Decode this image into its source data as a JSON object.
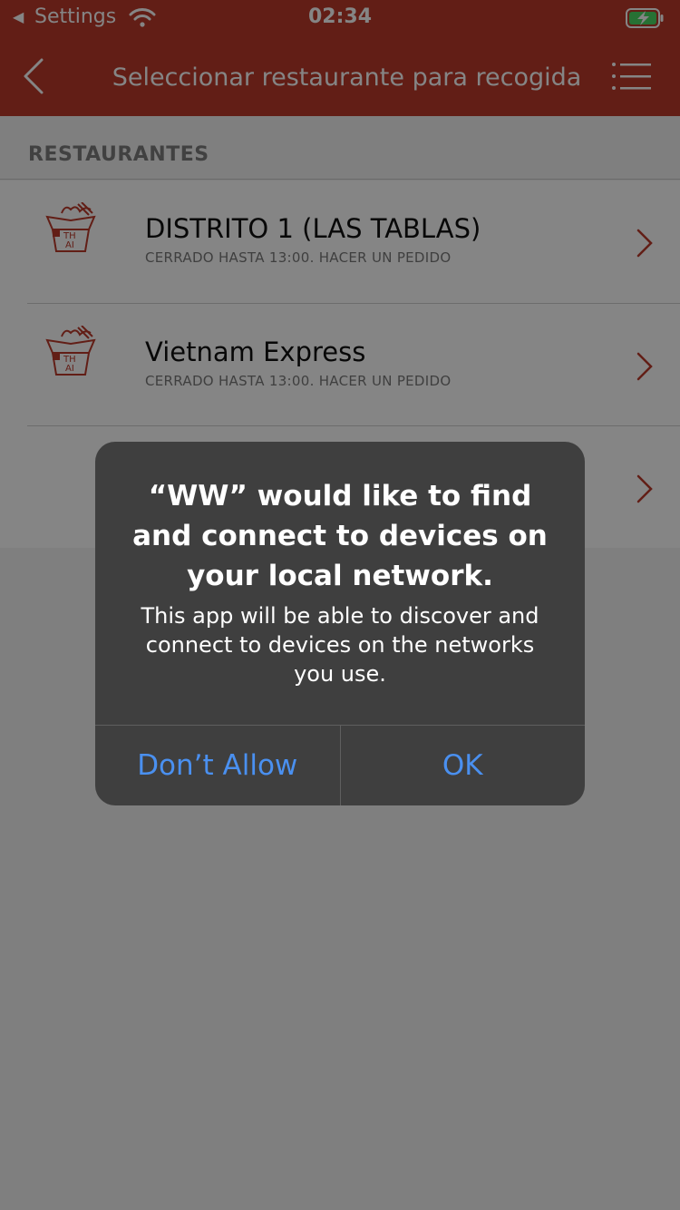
{
  "status_bar": {
    "back_app": "Settings",
    "time": "02:34"
  },
  "nav": {
    "title": "Seleccionar restaurante para recogida"
  },
  "section": {
    "header": "RESTAURANTES"
  },
  "restaurants": [
    {
      "name": "DISTRITO 1 (LAS TABLAS)",
      "status": "CERRADO HASTA 13:00. HACER UN PEDIDO",
      "icon": "thai-box-icon"
    },
    {
      "name": "Vietnam Express",
      "status": "CERRADO HASTA 13:00. HACER UN PEDIDO",
      "icon": "thai-box-icon"
    },
    {
      "name": "",
      "status": "",
      "icon": ""
    }
  ],
  "dialog": {
    "title": "“WW” would like to find and connect to devices on your local network.",
    "message": "This app will be able to discover and connect to devices on the networks you use.",
    "deny_label": "Don’t Allow",
    "ok_label": "OK"
  },
  "colors": {
    "brand": "#bc3a2b",
    "link": "#4a90f0",
    "dialog_bg": "#3f3f3f",
    "battery_charging": "#4cd964"
  }
}
